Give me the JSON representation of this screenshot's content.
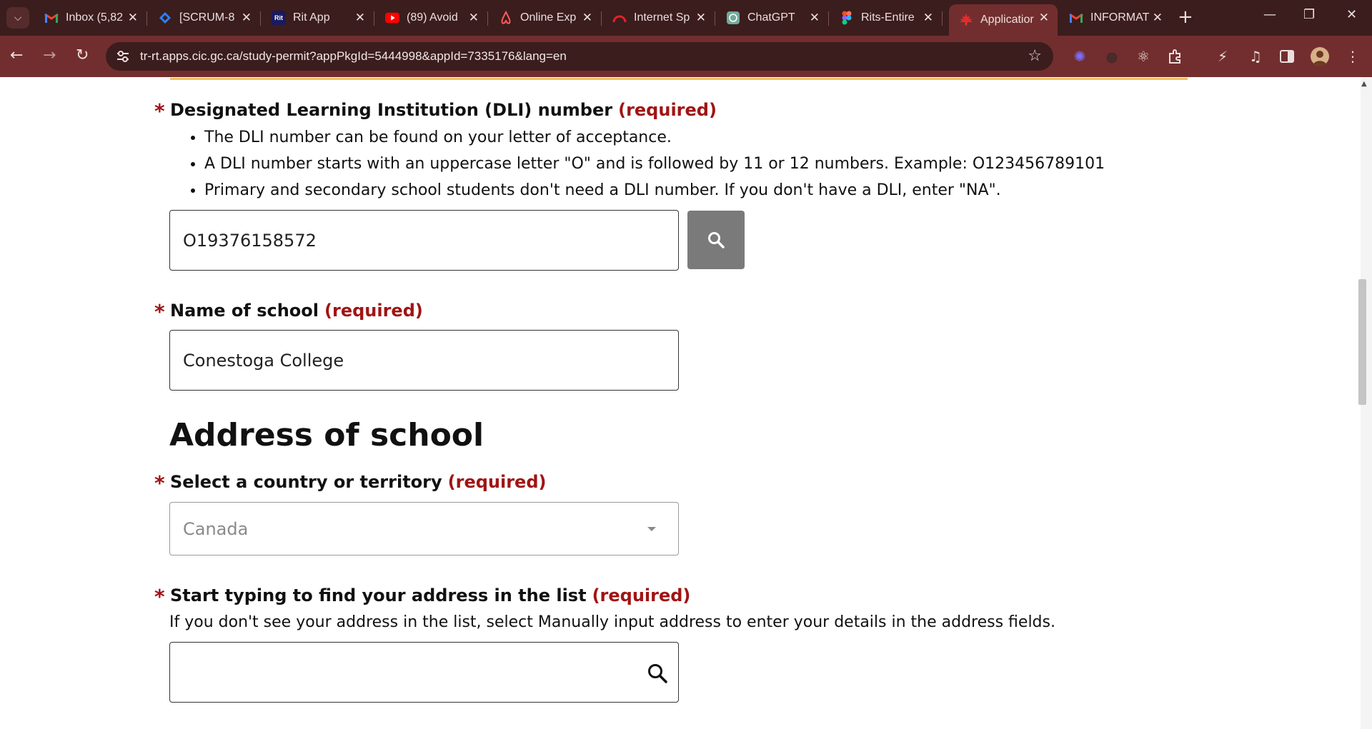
{
  "browser": {
    "tabs": [
      {
        "title": "Inbox (5,82",
        "icon": "gmail-icon"
      },
      {
        "title": "[SCRUM-8",
        "icon": "jira-icon"
      },
      {
        "title": "Rit App",
        "icon": "rit-app-icon",
        "icon_text": "Rit"
      },
      {
        "title": "(89) Avoid",
        "icon": "youtube-icon"
      },
      {
        "title": "Online Exp",
        "icon": "airbnb-icon"
      },
      {
        "title": "Internet Sp",
        "icon": "speedtest-icon"
      },
      {
        "title": "ChatGPT",
        "icon": "chatgpt-icon"
      },
      {
        "title": "Rits-Entire",
        "icon": "figma-icon"
      },
      {
        "title": "Applicatior",
        "icon": "canada-maple-leaf-icon",
        "active": true
      },
      {
        "title": "INFORMAT",
        "icon": "gmail-icon"
      }
    ],
    "url": "tr-rt.apps.cic.gc.ca/study-permit?appPkgId=5444998&appId=7335176&lang=en"
  },
  "form": {
    "dli": {
      "label": "Designated Learning Institution (DLI) number",
      "required_text": "(required)",
      "hints": [
        "The DLI number can be found on your letter of acceptance.",
        "A DLI number starts with an uppercase letter \"O\" and is followed by 11 or 12 numbers. Example: O123456789101",
        "Primary and secondary school students don't need a DLI number. If you don't have a DLI, enter \"NA\"."
      ],
      "value": "O19376158572"
    },
    "school_name": {
      "label": "Name of school",
      "required_text": "(required)",
      "value": "Conestoga College"
    },
    "address_heading": "Address of school",
    "country": {
      "label": "Select a country or territory",
      "required_text": "(required)",
      "value": "Canada"
    },
    "address_search": {
      "label": "Start typing to find your address in the list",
      "required_text": "(required)",
      "hint": "If you don't see your address in the list, select Manually input address to enter your details in the address fields.",
      "value": ""
    }
  },
  "colors": {
    "required": "#a01414",
    "chrome_dark": "#3b1d1d",
    "chrome_toolbar": "#722e2e",
    "search_button": "#7a7a7a"
  }
}
